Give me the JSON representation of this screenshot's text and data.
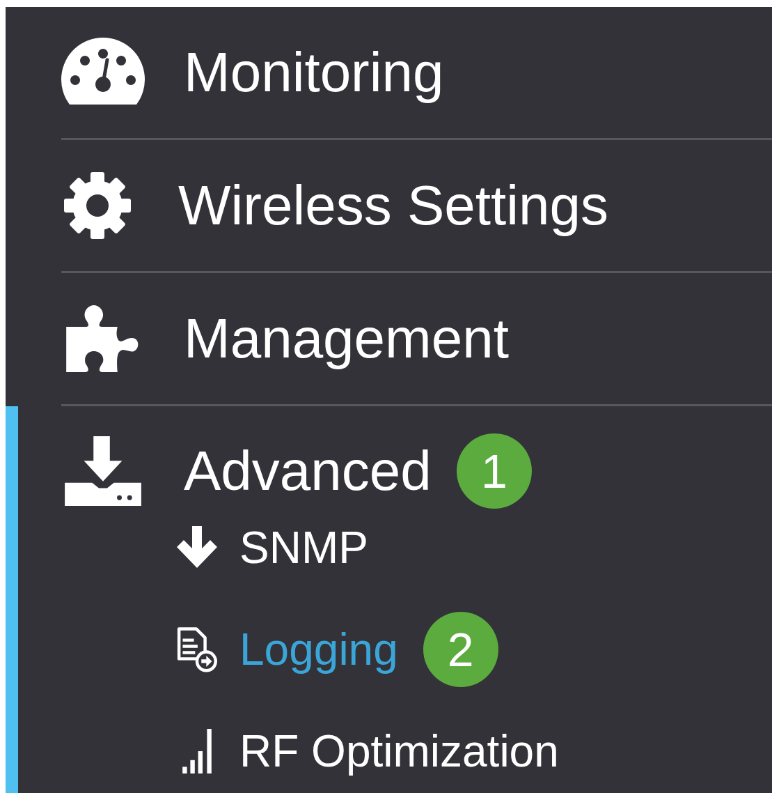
{
  "menu": [
    {
      "label": "Monitoring",
      "kind": "gauge",
      "expanded": false
    },
    {
      "label": "Wireless Settings",
      "kind": "gear",
      "expanded": false
    },
    {
      "label": "Management",
      "kind": "puzzle",
      "expanded": false
    },
    {
      "label": "Advanced",
      "kind": "download",
      "expanded": true,
      "badge": "1",
      "children": [
        {
          "label": "SNMP",
          "kind": "arrow",
          "selected": false
        },
        {
          "label": "Logging",
          "kind": "log",
          "selected": true,
          "badge": "2"
        },
        {
          "label": "RF Optimization",
          "kind": "signal",
          "selected": false
        }
      ]
    }
  ]
}
